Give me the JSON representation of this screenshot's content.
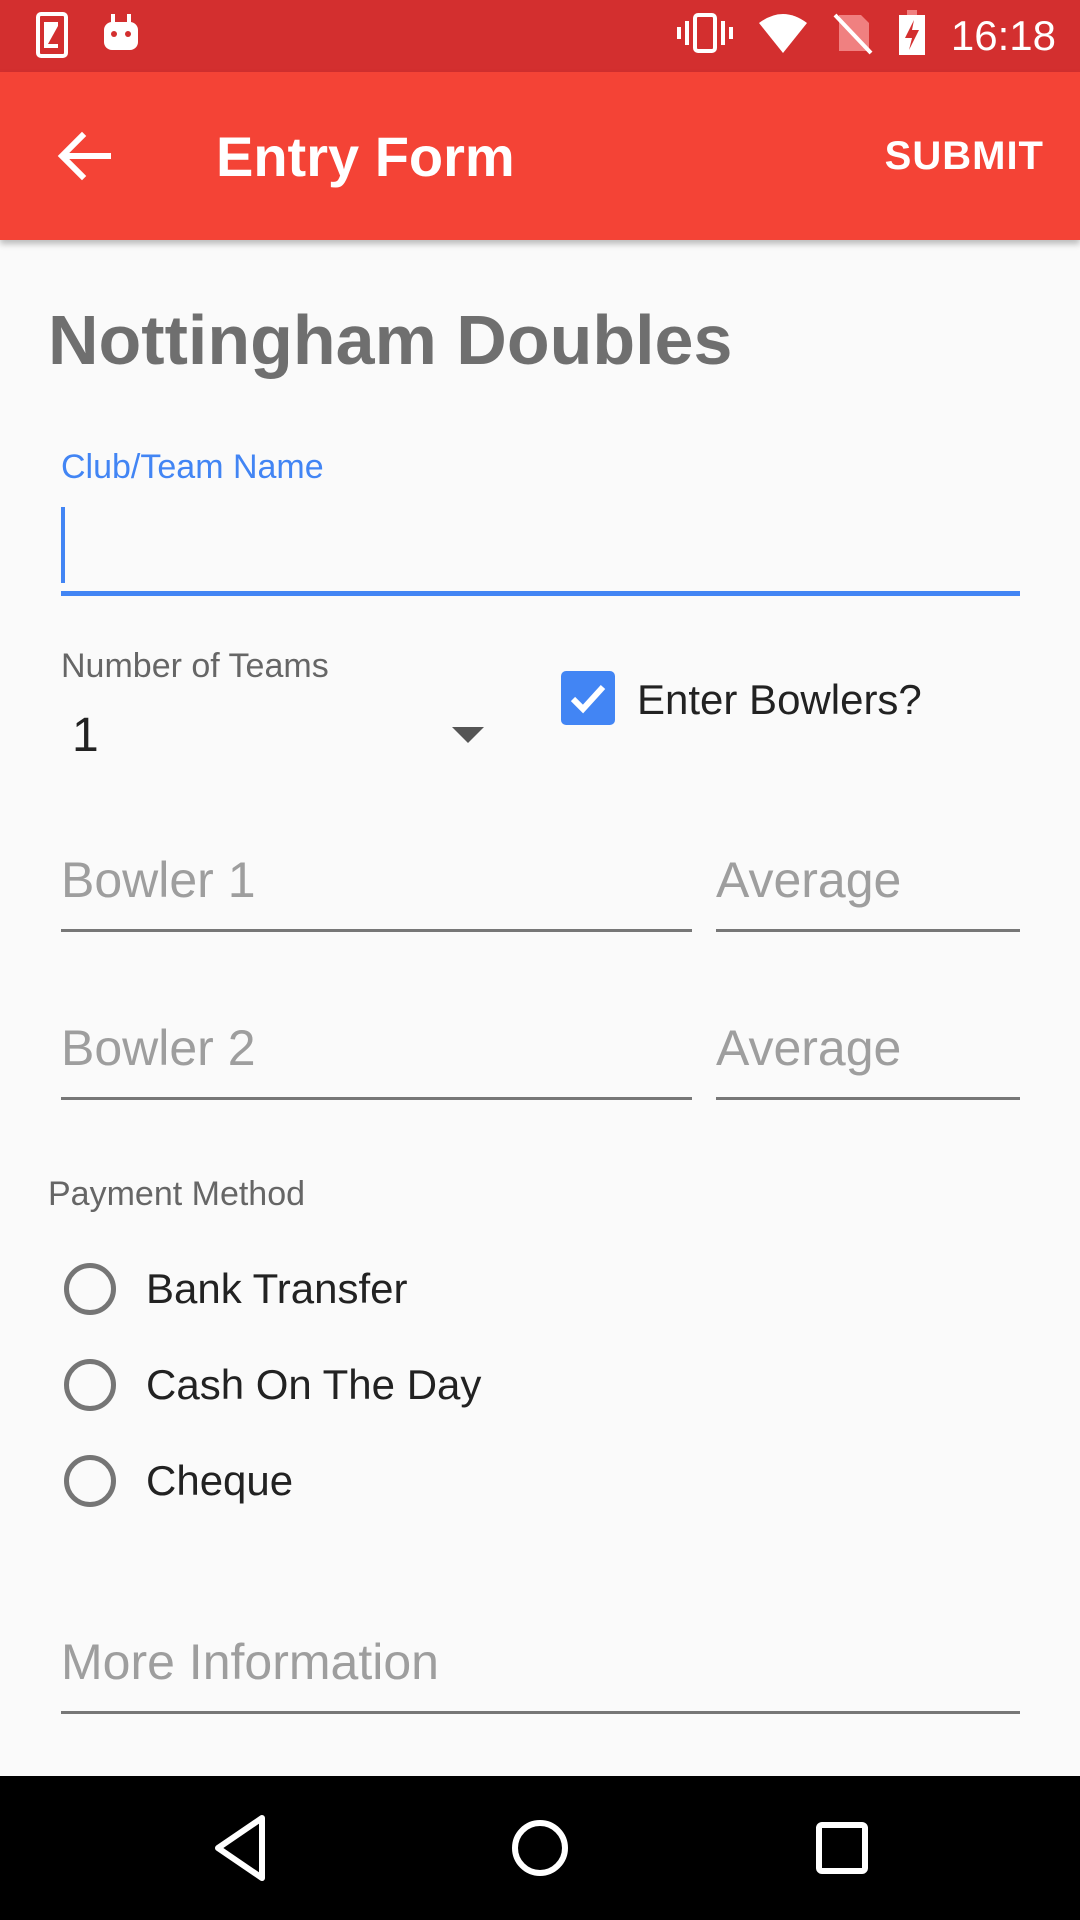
{
  "status_bar": {
    "time": "16:18",
    "left_icons": [
      "sim-card-icon",
      "android-debug-icon"
    ],
    "right_icons": [
      "vibrate-icon",
      "wifi-icon",
      "no-sim-icon",
      "battery-charging-icon"
    ]
  },
  "app_bar": {
    "title": "Entry Form",
    "submit_label": "SUBMIT",
    "back_icon": "arrow-back-icon",
    "color": "#f44336"
  },
  "form": {
    "title": "Nottingham Doubles",
    "team_name": {
      "label": "Club/Team Name",
      "value": ""
    },
    "num_teams": {
      "label": "Number of Teams",
      "value": "1"
    },
    "enter_bowlers": {
      "label": "Enter Bowlers?",
      "checked": true
    },
    "bowlers": [
      {
        "name_placeholder": "Bowler 1",
        "average_placeholder": "Average"
      },
      {
        "name_placeholder": "Bowler 2",
        "average_placeholder": "Average"
      }
    ],
    "payment": {
      "label": "Payment Method",
      "options": [
        "Bank Transfer",
        "Cash On The Day",
        "Cheque"
      ]
    },
    "more_info": {
      "placeholder": "More Information"
    }
  },
  "accent_color": "#4285f4",
  "nav_bar": {
    "icons": [
      "back-triangle-icon",
      "home-circle-icon",
      "recents-square-icon"
    ]
  }
}
